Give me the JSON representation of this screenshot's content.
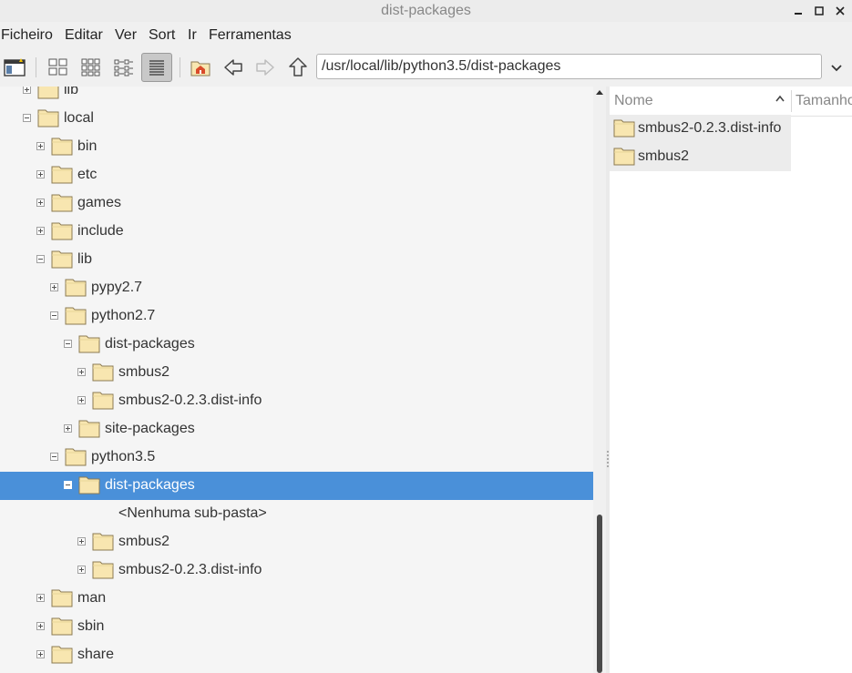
{
  "window": {
    "title": "dist-packages"
  },
  "menu": [
    "Ficheiro",
    "Editar",
    "Ver",
    "Sort",
    "Ir",
    "Ferramentas"
  ],
  "address": {
    "path": "/usr/local/lib/python3.5/dist-packages"
  },
  "icons": {
    "new_window": "new-window-icon",
    "view_icons": "icon-view-icon",
    "view_thumbs": "thumbnail-view-icon",
    "view_compact": "compact-view-icon",
    "view_list": "list-view-icon",
    "home": "home-icon",
    "back": "back-arrow-icon",
    "forward": "forward-arrow-icon",
    "up": "up-arrow-icon"
  },
  "colors": {
    "selection": "#4a90d9",
    "folder_fill": "#f8e6b0",
    "folder_stroke": "#8b7a52"
  },
  "tree": [
    {
      "label": "lib",
      "level": 1,
      "expander": "plus",
      "folder": true
    },
    {
      "label": "local",
      "level": 1,
      "expander": "minus",
      "folder": true
    },
    {
      "label": "bin",
      "level": 2,
      "expander": "plus",
      "folder": true
    },
    {
      "label": "etc",
      "level": 2,
      "expander": "plus",
      "folder": true
    },
    {
      "label": "games",
      "level": 2,
      "expander": "plus",
      "folder": true
    },
    {
      "label": "include",
      "level": 2,
      "expander": "plus",
      "folder": true
    },
    {
      "label": "lib",
      "level": 2,
      "expander": "minus",
      "folder": true
    },
    {
      "label": "pypy2.7",
      "level": 3,
      "expander": "plus",
      "folder": true
    },
    {
      "label": "python2.7",
      "level": 3,
      "expander": "minus",
      "folder": true
    },
    {
      "label": "dist-packages",
      "level": 4,
      "expander": "minus",
      "folder": true
    },
    {
      "label": "smbus2",
      "level": 5,
      "expander": "plus",
      "folder": true
    },
    {
      "label": "smbus2-0.2.3.dist-info",
      "level": 5,
      "expander": "plus",
      "folder": true
    },
    {
      "label": "site-packages",
      "level": 4,
      "expander": "plus",
      "folder": true
    },
    {
      "label": "python3.5",
      "level": 3,
      "expander": "minus",
      "folder": true
    },
    {
      "label": "dist-packages",
      "level": 4,
      "expander": "minus",
      "folder": true,
      "selected": true
    },
    {
      "label": "<Nenhuma sub-pasta>",
      "level": 5,
      "expander": "none",
      "folder": false
    },
    {
      "label": "smbus2",
      "level": 5,
      "expander": "plus",
      "folder": true
    },
    {
      "label": "smbus2-0.2.3.dist-info",
      "level": 5,
      "expander": "plus",
      "folder": true
    },
    {
      "label": "man",
      "level": 2,
      "expander": "plus",
      "folder": true
    },
    {
      "label": "sbin",
      "level": 2,
      "expander": "plus",
      "folder": true
    },
    {
      "label": "share",
      "level": 2,
      "expander": "plus",
      "folder": true
    }
  ],
  "filelist": {
    "columns": {
      "name": "Nome",
      "size": "Tamanho"
    },
    "items": [
      {
        "name": "smbus2-0.2.3.dist-info"
      },
      {
        "name": "smbus2"
      }
    ]
  }
}
